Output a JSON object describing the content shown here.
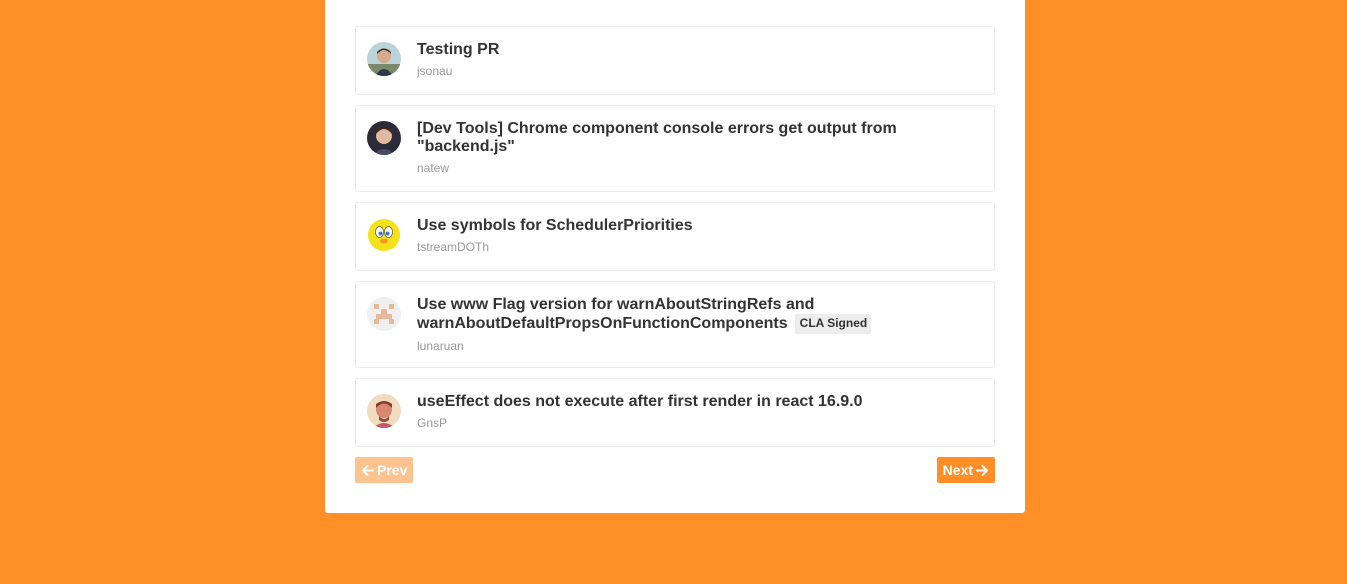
{
  "theme": {
    "background": "#ff8f26",
    "card": "#ffffff",
    "accent": "#ff8f26",
    "accent_disabled": "#ffc38f"
  },
  "pull_requests": [
    {
      "title": "Testing PR",
      "author": "jsonau",
      "avatar": "avatar-jsonau"
    },
    {
      "title": "[Dev Tools] Chrome component console errors get output from \"backend.js\"",
      "author": "natew",
      "avatar": "avatar-natew"
    },
    {
      "title": "Use symbols for SchedulerPriorities",
      "author": "tstreamDOTh",
      "avatar": "avatar-tstreamDOTh"
    },
    {
      "title": "Use www Flag version for warnAboutStringRefs and warnAboutDefaultPropsOnFunctionComponents",
      "author": "lunaruan",
      "avatar": "avatar-lunaruan",
      "label": "CLA Signed"
    },
    {
      "title": "useEffect does not execute after first render in react 16.9.0",
      "author": "GnsP",
      "avatar": "avatar-GnsP"
    }
  ],
  "pagination": {
    "prev_label": "Prev",
    "next_label": "Next",
    "prev_icon": "arrow-left-icon",
    "next_icon": "arrow-right-icon"
  }
}
